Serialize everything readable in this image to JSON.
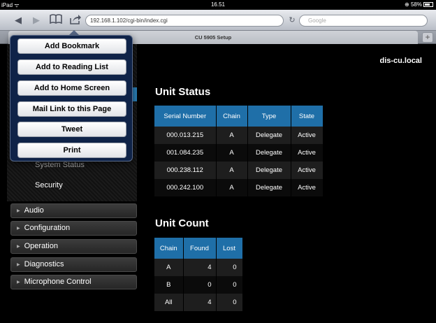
{
  "status_bar": {
    "carrier": "iPad",
    "time": "16.51",
    "battery": "58%"
  },
  "browser": {
    "url": "192.168.1.102/cgi-bin/index.cgi",
    "search_placeholder": "Google",
    "tab_title": "CU 5905 Setup",
    "add_tab": "+"
  },
  "share_menu": {
    "items": [
      "Add Bookmark",
      "Add to Reading List",
      "Add to Home Screen",
      "Mail Link to this Page",
      "Tweet",
      "Print"
    ]
  },
  "hostname": "dis-cu.local",
  "sidebar": {
    "sub_items": [
      "System Status",
      "Security"
    ],
    "menu": [
      "Audio",
      "Configuration",
      "Operation",
      "Diagnostics",
      "Microphone Control"
    ]
  },
  "unit_status": {
    "title": "Unit Status",
    "headers": [
      "Serial Number",
      "Chain",
      "Type",
      "State"
    ],
    "rows": [
      [
        "000.013.215",
        "A",
        "Delegate",
        "Active"
      ],
      [
        "001.084.235",
        "A",
        "Delegate",
        "Active"
      ],
      [
        "000.238.112",
        "A",
        "Delegate",
        "Active"
      ],
      [
        "000.242.100",
        "A",
        "Delegate",
        "Active"
      ]
    ]
  },
  "unit_count": {
    "title": "Unit Count",
    "headers": [
      "Chain",
      "Found",
      "Lost"
    ],
    "rows": [
      [
        "A",
        "4",
        "0"
      ],
      [
        "B",
        "0",
        "0"
      ],
      [
        "All",
        "4",
        "0"
      ]
    ]
  },
  "colors": {
    "accent": "#1f6fa8",
    "popover": "#0f2348"
  }
}
